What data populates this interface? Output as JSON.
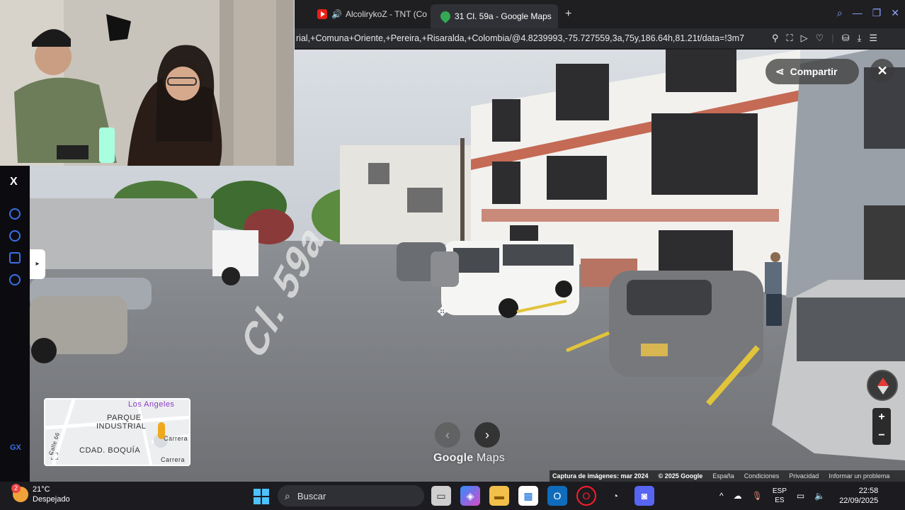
{
  "browser": {
    "tabs": [
      {
        "label": "AlcolirykoZ - TNT (Co",
        "icon": "youtube-icon"
      },
      {
        "label": "31 Cl. 59a - Google Maps",
        "icon": "google-maps-icon"
      }
    ],
    "url": "rial,+Comuna+Oriente,+Pereira,+Risaralda,+Colombia/@4.8239993,-75.727559,3a,75y,186.64h,81.21t/data=!3m7"
  },
  "maps": {
    "share_label": "Compartir",
    "logo_google": "Google",
    "logo_maps": "Maps",
    "street_marking": "Cl. 59a",
    "minimap": {
      "label_top_right": "Los Angeles",
      "label_parque": "PARQUE",
      "label_industrial": "INDUSTRIAL",
      "label_cdad": "CDAD. BOQUÍA",
      "label_carrera_1": "Carrera",
      "label_carrera_2": "Carrera",
      "label_road": "Calle 66"
    },
    "credits": {
      "capture": "Captura de imágenes: mar 2024",
      "copyright": "© 2025 Google",
      "region": "España",
      "terms": "Condiciones",
      "privacy": "Privacidad",
      "report": "Informar un problema"
    }
  },
  "sidebar": {
    "x_label": "X",
    "gx_label": "GX"
  },
  "taskbar": {
    "weather_badge": "2",
    "temp": "21°C",
    "condition": "Despejado",
    "search_placeholder": "Buscar",
    "lang_1": "ESP",
    "lang_2": "ES",
    "time": "22:58",
    "date": "22/09/2025"
  },
  "colors": {
    "accent": "#3b6ee8",
    "browser_bg": "#1f1f22",
    "taskbar_bg": "#1c1c20"
  }
}
